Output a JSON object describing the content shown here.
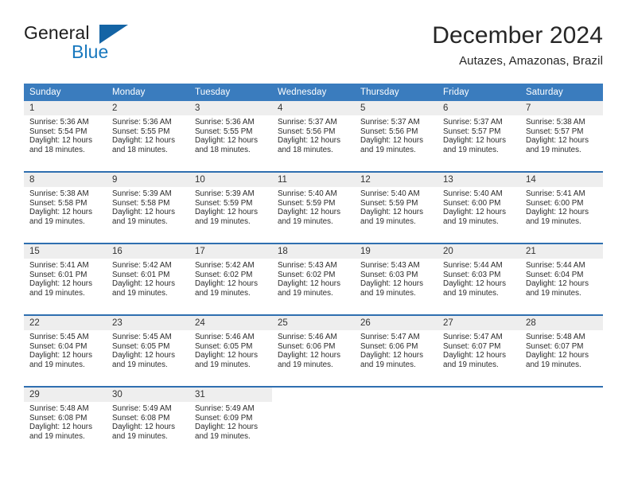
{
  "brand": {
    "name_part1": "General",
    "name_part2": "Blue",
    "triangle_icon": "triangle-logo-icon"
  },
  "header": {
    "month_title": "December 2024",
    "location": "Autazes, Amazonas, Brazil"
  },
  "colors": {
    "header_blue": "#3a7cbe",
    "separator_blue": "#2f6fb0",
    "daynum_bg": "#eeeeee",
    "brand_blue": "#1878be",
    "text": "#2b2b2b"
  },
  "calendar": {
    "weekdays": [
      "Sunday",
      "Monday",
      "Tuesday",
      "Wednesday",
      "Thursday",
      "Friday",
      "Saturday"
    ],
    "weeks": [
      [
        {
          "day": "1",
          "sunrise": "Sunrise: 5:36 AM",
          "sunset": "Sunset: 5:54 PM",
          "daylight": "Daylight: 12 hours and 18 minutes."
        },
        {
          "day": "2",
          "sunrise": "Sunrise: 5:36 AM",
          "sunset": "Sunset: 5:55 PM",
          "daylight": "Daylight: 12 hours and 18 minutes."
        },
        {
          "day": "3",
          "sunrise": "Sunrise: 5:36 AM",
          "sunset": "Sunset: 5:55 PM",
          "daylight": "Daylight: 12 hours and 18 minutes."
        },
        {
          "day": "4",
          "sunrise": "Sunrise: 5:37 AM",
          "sunset": "Sunset: 5:56 PM",
          "daylight": "Daylight: 12 hours and 18 minutes."
        },
        {
          "day": "5",
          "sunrise": "Sunrise: 5:37 AM",
          "sunset": "Sunset: 5:56 PM",
          "daylight": "Daylight: 12 hours and 19 minutes."
        },
        {
          "day": "6",
          "sunrise": "Sunrise: 5:37 AM",
          "sunset": "Sunset: 5:57 PM",
          "daylight": "Daylight: 12 hours and 19 minutes."
        },
        {
          "day": "7",
          "sunrise": "Sunrise: 5:38 AM",
          "sunset": "Sunset: 5:57 PM",
          "daylight": "Daylight: 12 hours and 19 minutes."
        }
      ],
      [
        {
          "day": "8",
          "sunrise": "Sunrise: 5:38 AM",
          "sunset": "Sunset: 5:58 PM",
          "daylight": "Daylight: 12 hours and 19 minutes."
        },
        {
          "day": "9",
          "sunrise": "Sunrise: 5:39 AM",
          "sunset": "Sunset: 5:58 PM",
          "daylight": "Daylight: 12 hours and 19 minutes."
        },
        {
          "day": "10",
          "sunrise": "Sunrise: 5:39 AM",
          "sunset": "Sunset: 5:59 PM",
          "daylight": "Daylight: 12 hours and 19 minutes."
        },
        {
          "day": "11",
          "sunrise": "Sunrise: 5:40 AM",
          "sunset": "Sunset: 5:59 PM",
          "daylight": "Daylight: 12 hours and 19 minutes."
        },
        {
          "day": "12",
          "sunrise": "Sunrise: 5:40 AM",
          "sunset": "Sunset: 5:59 PM",
          "daylight": "Daylight: 12 hours and 19 minutes."
        },
        {
          "day": "13",
          "sunrise": "Sunrise: 5:40 AM",
          "sunset": "Sunset: 6:00 PM",
          "daylight": "Daylight: 12 hours and 19 minutes."
        },
        {
          "day": "14",
          "sunrise": "Sunrise: 5:41 AM",
          "sunset": "Sunset: 6:00 PM",
          "daylight": "Daylight: 12 hours and 19 minutes."
        }
      ],
      [
        {
          "day": "15",
          "sunrise": "Sunrise: 5:41 AM",
          "sunset": "Sunset: 6:01 PM",
          "daylight": "Daylight: 12 hours and 19 minutes."
        },
        {
          "day": "16",
          "sunrise": "Sunrise: 5:42 AM",
          "sunset": "Sunset: 6:01 PM",
          "daylight": "Daylight: 12 hours and 19 minutes."
        },
        {
          "day": "17",
          "sunrise": "Sunrise: 5:42 AM",
          "sunset": "Sunset: 6:02 PM",
          "daylight": "Daylight: 12 hours and 19 minutes."
        },
        {
          "day": "18",
          "sunrise": "Sunrise: 5:43 AM",
          "sunset": "Sunset: 6:02 PM",
          "daylight": "Daylight: 12 hours and 19 minutes."
        },
        {
          "day": "19",
          "sunrise": "Sunrise: 5:43 AM",
          "sunset": "Sunset: 6:03 PM",
          "daylight": "Daylight: 12 hours and 19 minutes."
        },
        {
          "day": "20",
          "sunrise": "Sunrise: 5:44 AM",
          "sunset": "Sunset: 6:03 PM",
          "daylight": "Daylight: 12 hours and 19 minutes."
        },
        {
          "day": "21",
          "sunrise": "Sunrise: 5:44 AM",
          "sunset": "Sunset: 6:04 PM",
          "daylight": "Daylight: 12 hours and 19 minutes."
        }
      ],
      [
        {
          "day": "22",
          "sunrise": "Sunrise: 5:45 AM",
          "sunset": "Sunset: 6:04 PM",
          "daylight": "Daylight: 12 hours and 19 minutes."
        },
        {
          "day": "23",
          "sunrise": "Sunrise: 5:45 AM",
          "sunset": "Sunset: 6:05 PM",
          "daylight": "Daylight: 12 hours and 19 minutes."
        },
        {
          "day": "24",
          "sunrise": "Sunrise: 5:46 AM",
          "sunset": "Sunset: 6:05 PM",
          "daylight": "Daylight: 12 hours and 19 minutes."
        },
        {
          "day": "25",
          "sunrise": "Sunrise: 5:46 AM",
          "sunset": "Sunset: 6:06 PM",
          "daylight": "Daylight: 12 hours and 19 minutes."
        },
        {
          "day": "26",
          "sunrise": "Sunrise: 5:47 AM",
          "sunset": "Sunset: 6:06 PM",
          "daylight": "Daylight: 12 hours and 19 minutes."
        },
        {
          "day": "27",
          "sunrise": "Sunrise: 5:47 AM",
          "sunset": "Sunset: 6:07 PM",
          "daylight": "Daylight: 12 hours and 19 minutes."
        },
        {
          "day": "28",
          "sunrise": "Sunrise: 5:48 AM",
          "sunset": "Sunset: 6:07 PM",
          "daylight": "Daylight: 12 hours and 19 minutes."
        }
      ],
      [
        {
          "day": "29",
          "sunrise": "Sunrise: 5:48 AM",
          "sunset": "Sunset: 6:08 PM",
          "daylight": "Daylight: 12 hours and 19 minutes."
        },
        {
          "day": "30",
          "sunrise": "Sunrise: 5:49 AM",
          "sunset": "Sunset: 6:08 PM",
          "daylight": "Daylight: 12 hours and 19 minutes."
        },
        {
          "day": "31",
          "sunrise": "Sunrise: 5:49 AM",
          "sunset": "Sunset: 6:09 PM",
          "daylight": "Daylight: 12 hours and 19 minutes."
        },
        {
          "day": "",
          "sunrise": "",
          "sunset": "",
          "daylight": ""
        },
        {
          "day": "",
          "sunrise": "",
          "sunset": "",
          "daylight": ""
        },
        {
          "day": "",
          "sunrise": "",
          "sunset": "",
          "daylight": ""
        },
        {
          "day": "",
          "sunrise": "",
          "sunset": "",
          "daylight": ""
        }
      ]
    ]
  }
}
